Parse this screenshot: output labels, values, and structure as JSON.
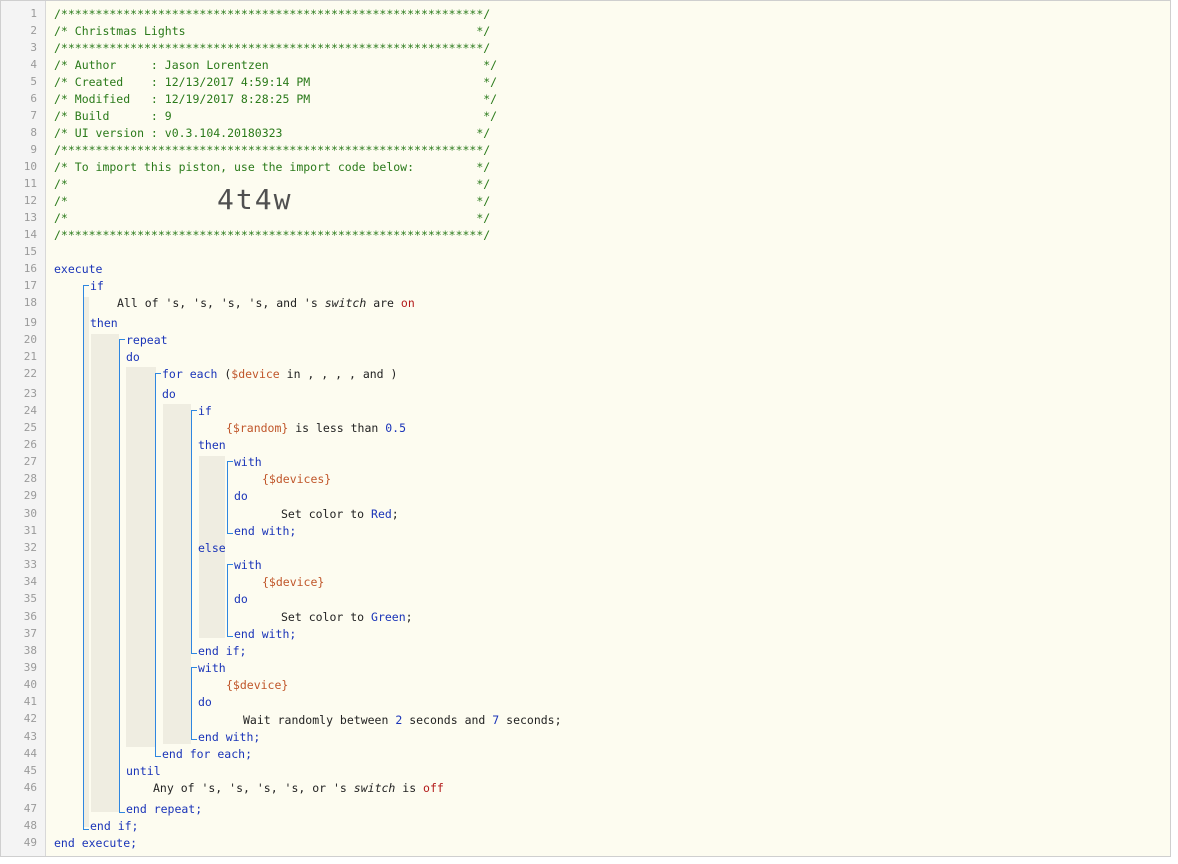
{
  "header": {
    "border_line": "/*************************************************************/",
    "title_line": "/* Christmas Lights                                          */",
    "author_line": "/* Author     : Jason Lorentzen                               */",
    "created_line": "/* Created    : 12/13/2017 4:59:14 PM                         */",
    "modified_line": "/* Modified   : 12/19/2017 8:28:25 PM                         */",
    "build_line": "/* Build      : 9                                             */",
    "ui_line": "/* UI version : v0.3.104.20180323                            */",
    "import_line": "/* To import this piston, use the import code below:         */",
    "blank_line": "/*                                                           */",
    "import_code": "4t4w"
  },
  "kw": {
    "execute": "execute",
    "if": "if",
    "then": "then",
    "else": "else",
    "repeat": "repeat",
    "do": "do",
    "for_each": "for each",
    "with": "with",
    "until": "until",
    "end_if": "end if;",
    "end_with": "end with;",
    "end_for_each": "end for each;",
    "end_repeat": "end repeat;",
    "end_execute": "end execute;"
  },
  "cond1": {
    "prefix": "All of 's, 's, 's, 's, and 's ",
    "attr": "switch",
    "mid": " are ",
    "value": "on"
  },
  "foreach": {
    "open": "(",
    "var": "$device",
    "rest": " in , , , , and )"
  },
  "cond2": {
    "var": "{$random}",
    "mid": " is less than ",
    "num": "0.5"
  },
  "with1": {
    "var": "{$devices}"
  },
  "action1": {
    "prefix": "Set color to ",
    "value": "Red",
    "end": ";"
  },
  "with2": {
    "var": "{$device}"
  },
  "action2": {
    "prefix": "Set color to ",
    "value": "Green",
    "end": ";"
  },
  "with3": {
    "var": "{$device}"
  },
  "wait": {
    "prefix": "Wait randomly between ",
    "n1": "2",
    "mid": " seconds and ",
    "n2": "7",
    "end": " seconds;"
  },
  "cond3": {
    "prefix": "Any of 's, 's, 's, 's, or 's ",
    "attr": "switch",
    "mid": " is ",
    "value": "off"
  },
  "line_numbers": [
    "1",
    "2",
    "3",
    "4",
    "5",
    "6",
    "7",
    "8",
    "9",
    "10",
    "11",
    "12",
    "13",
    "14",
    "15",
    "16",
    "17",
    "18",
    "19",
    "20",
    "21",
    "22",
    "23",
    "24",
    "25",
    "26",
    "27",
    "28",
    "29",
    "30",
    "31",
    "32",
    "33",
    "34",
    "35",
    "36",
    "37",
    "38",
    "39",
    "40",
    "41",
    "42",
    "43",
    "44",
    "45",
    "46",
    "47",
    "48",
    "49"
  ],
  "colors": {
    "comment": "#2a7a1a",
    "keyword": "#1a34b8",
    "variable": "#c0562a",
    "value": "#b31a1a",
    "bracket": "#2e86e0"
  }
}
